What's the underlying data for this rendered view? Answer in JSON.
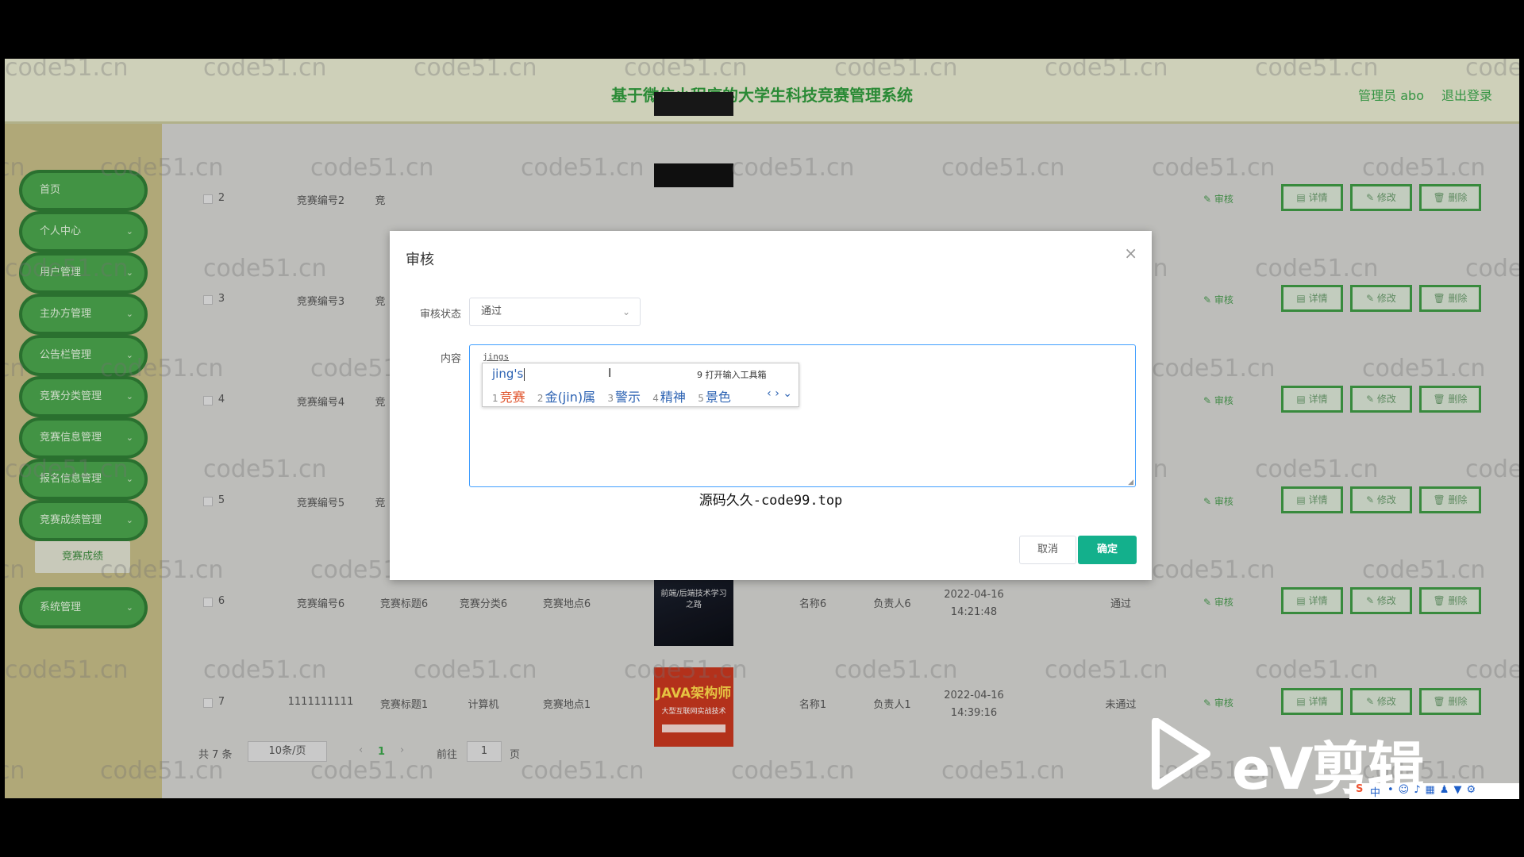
{
  "header": {
    "title": "基于微信小程序的大学生科技竞赛管理系统",
    "admin_label": "管理员 abo",
    "logout_label": "退出登录"
  },
  "sidebar": {
    "items": [
      {
        "label": "首页",
        "has_children": false
      },
      {
        "label": "个人中心",
        "has_children": true
      },
      {
        "label": "用户管理",
        "has_children": true
      },
      {
        "label": "主办方管理",
        "has_children": true
      },
      {
        "label": "公告栏管理",
        "has_children": true
      },
      {
        "label": "竞赛分类管理",
        "has_children": true
      },
      {
        "label": "竞赛信息管理",
        "has_children": true
      },
      {
        "label": "报名信息管理",
        "has_children": true
      },
      {
        "label": "竞赛成绩管理",
        "has_children": true
      },
      {
        "label": "系统管理",
        "has_children": true
      }
    ],
    "submenu_label": "竞赛成绩",
    "chevron": "⌄"
  },
  "table": {
    "rows": [
      {
        "index": "2",
        "code": "竞赛编号2",
        "title": "竞",
        "category": "",
        "place": "",
        "name": "",
        "owner": "",
        "time": "",
        "status": ""
      },
      {
        "index": "3",
        "code": "竞赛编号3",
        "title": "竞",
        "category": "",
        "place": "",
        "name": "",
        "owner": "",
        "time": "",
        "status": ""
      },
      {
        "index": "4",
        "code": "竞赛编号4",
        "title": "竞",
        "category": "",
        "place": "",
        "name": "",
        "owner": "",
        "time": "",
        "status": ""
      },
      {
        "index": "5",
        "code": "竞赛编号5",
        "title": "竞",
        "category": "",
        "place": "",
        "name": "",
        "owner": "",
        "time": "",
        "status": ""
      },
      {
        "index": "6",
        "code": "竞赛编号6",
        "title": "竞赛标题6",
        "category": "竞赛分类6",
        "place": "竞赛地点6",
        "name": "名称6",
        "owner": "负责人6",
        "time": "2022-04-16\n14:21:48",
        "status": "通过"
      },
      {
        "index": "7",
        "code": "1111111111",
        "title": "竞赛标题1",
        "category": "计算机",
        "place": "竞赛地点1",
        "name": "名称1",
        "owner": "负责人1",
        "time": "2022-04-16\n14:39:16",
        "status": "未通过"
      }
    ],
    "audit_label": "审核",
    "detail_label": "详情",
    "edit_label": "修改",
    "delete_label": "删除",
    "thumb6_text": "前端/后端技术学习之路",
    "thumb7_text": "JAVA架构师",
    "thumb7_sub": "大型互联网实战技术"
  },
  "pager": {
    "total": "共 7 条",
    "page_size": "10条/页",
    "current_page": "1",
    "goto_label": "前往",
    "goto_value": "1",
    "page_unit": "页"
  },
  "dialog": {
    "title": "审核",
    "close": "×",
    "status_label": "审核状态",
    "status_value": "通过",
    "content_label": "内容",
    "typed_text": "jings",
    "ime_composition": "jing's",
    "ime_toolbox": "9 打开输入工具箱",
    "ime_candidates": [
      {
        "n": "1",
        "text": "竞赛"
      },
      {
        "n": "2",
        "text": "金(jin)属"
      },
      {
        "n": "3",
        "text": "警示"
      },
      {
        "n": "4",
        "text": "精神"
      },
      {
        "n": "5",
        "text": "景色"
      }
    ],
    "ime_nav": "‹ › ⌄",
    "overlay_text": "源码久久-code99.top",
    "cancel_label": "取消",
    "ok_label": "确定"
  },
  "watermark": "code51.cn",
  "branding": {
    "ev_text": "eV剪辑"
  },
  "taskbar": {
    "ime_indicator": "中"
  },
  "colors": {
    "primary_green": "#4aa44c",
    "confirm_teal": "#13b08c",
    "header_title_green": "#2f9a3c"
  }
}
